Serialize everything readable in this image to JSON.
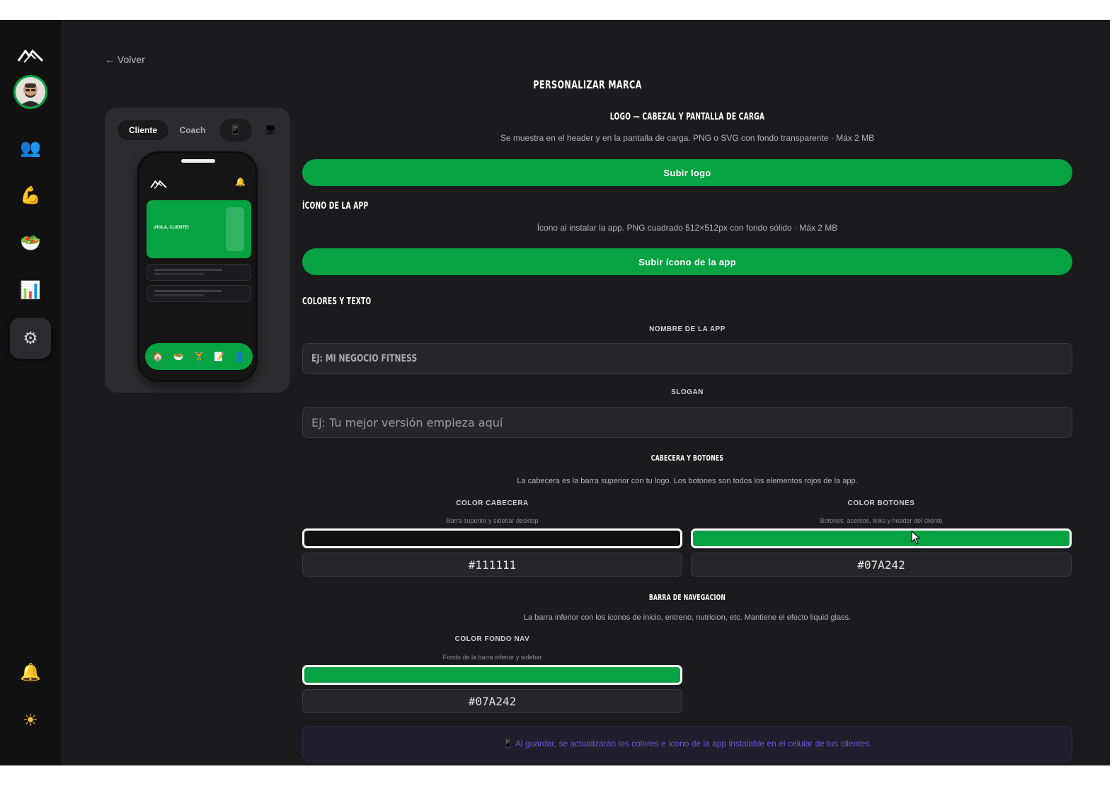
{
  "sidebar": {
    "items": [
      {
        "name": "clients",
        "glyph": "👥"
      },
      {
        "name": "training",
        "glyph": "💪"
      },
      {
        "name": "nutrition",
        "glyph": "🥗"
      },
      {
        "name": "stats",
        "glyph": "📊"
      },
      {
        "name": "settings",
        "glyph": "⚙"
      }
    ],
    "bottom": [
      {
        "name": "notifications",
        "glyph": "🔔"
      },
      {
        "name": "theme",
        "glyph": "☀"
      }
    ]
  },
  "nav": {
    "back_label": "← Volver"
  },
  "preview": {
    "tab_cliente": "Cliente",
    "tab_coach": "Coach",
    "device_mobile": "📱",
    "device_desktop": "🖥",
    "phone": {
      "greeting": "¡HOLA, CLIENTE!",
      "bell": "🔔",
      "nav_icons": [
        "🏠",
        "🥗",
        "🏋",
        "📝",
        "👤"
      ]
    }
  },
  "page": {
    "title": "PERSONALIZAR MARCA"
  },
  "logo_section": {
    "title": "LOGO — CABEZAL Y PANTALLA DE CARGA",
    "description": "Se muestra en el header y en la pantalla de carga. PNG o SVG con fondo transparente · Máx 2 MB",
    "button": "Subir logo"
  },
  "icon_section": {
    "title": "ÍCONO DE LA APP",
    "description": "Ícono al instalar la app. PNG cuadrado 512×512px con fondo sólido · Máx 2 MB",
    "button": "Subir ícono de la app"
  },
  "colors_section": {
    "title": "COLORES Y TEXTO",
    "app_name_label": "NOMBRE DE LA APP",
    "app_name_placeholder": "EJ: MI NEGOCIO FITNESS",
    "slogan_label": "SLOGAN",
    "slogan_placeholder": "Ej: Tu mejor versión empieza aquí"
  },
  "header_buttons": {
    "title": "CABECERA Y BOTONES",
    "description": "La cabecera es la barra superior con tu logo. Los botones son todos los elementos rojos de la app.",
    "header_color": {
      "label": "COLOR CABECERA",
      "sub": "Barra superior y sidebar desktop",
      "value": "#111111"
    },
    "button_color": {
      "label": "COLOR BOTONES",
      "sub": "Botones, acentos, links y header del cliente",
      "value": "#07A242"
    }
  },
  "navbar": {
    "title": "BARRA DE NAVEGACION",
    "description": "La barra inferior con los iconos de inicio, entreno, nutricion, etc. Mantiene el efecto liquid glass.",
    "nav_color": {
      "label": "COLOR FONDO NAV",
      "sub": "Fondo de la barra inferior y sidebar",
      "value": "#07A242"
    }
  },
  "info": {
    "text": "📱 Al guardar, se actualizarán los colores e ícono de la app instalable en el celular de tus clientes."
  },
  "colors": {
    "accent": "#07A242",
    "header": "#111111",
    "background": "#1b1b1d",
    "info_text": "#6b5bdc"
  }
}
